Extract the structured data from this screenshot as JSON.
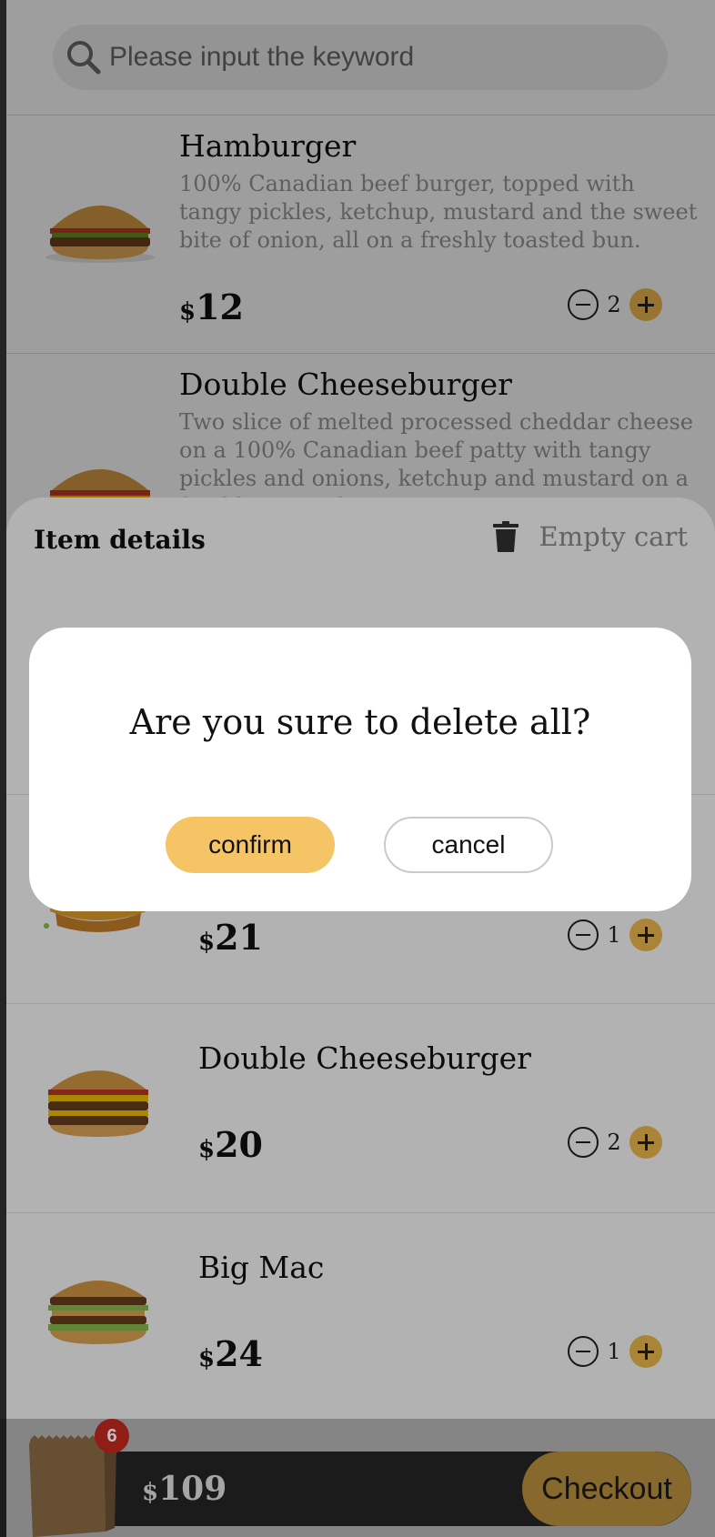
{
  "search": {
    "placeholder": "Please input the keyword",
    "icon": "search-icon"
  },
  "menu": {
    "items": [
      {
        "name": "Hamburger",
        "description": "100% Canadian beef burger, topped with tangy pickles, ketchup, mustard and the sweet bite of onion, all on a freshly toasted bun.",
        "currency": "$",
        "price": "12",
        "qty": "2"
      },
      {
        "name": "Double Cheeseburger",
        "description": "Two slice of melted processed cheddar cheese on a 100% Canadian beef patty with tangy pickles and onions, ketchup and mustard on a freshly-toasted",
        "currency": "$",
        "price": "",
        "qty": ""
      }
    ]
  },
  "cart": {
    "title": "Item details",
    "empty_label": "Empty cart",
    "items": [
      {
        "name": "",
        "currency": "$",
        "price": "21",
        "qty": "1"
      },
      {
        "name": "Double Cheeseburger",
        "currency": "$",
        "price": "20",
        "qty": "2"
      },
      {
        "name": "Big Mac",
        "currency": "$",
        "price": "24",
        "qty": "1"
      }
    ]
  },
  "bottom_bar": {
    "badge_count": "6",
    "currency": "$",
    "total": "109",
    "checkout_label": "Checkout"
  },
  "dialog": {
    "message": "Are you sure to delete all?",
    "confirm_label": "confirm",
    "cancel_label": "cancel"
  },
  "colors": {
    "accent": "#f4bd4f",
    "checkout": "#b58c3d",
    "badge": "#c0291f",
    "bar": "#242424"
  }
}
